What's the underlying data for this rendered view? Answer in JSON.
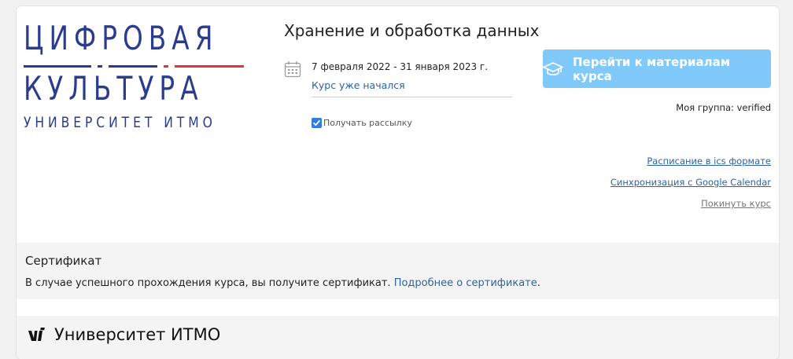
{
  "logo": {
    "line1": "ЦИФРОВАЯ",
    "line2": "КУЛЬТУРА",
    "line3": "УНИВЕРСИТЕТ ИТМО",
    "primary_color": "#2b3c8f",
    "accent_color": "#e0323f"
  },
  "course": {
    "title": "Хранение и обработка данных",
    "dates": "7 февраля 2022 - 31 января 2023 г.",
    "status": "Курс уже начался",
    "newsletter_label": "Получать рассылку",
    "newsletter_checked": true
  },
  "actions": {
    "go_button": "Перейти к материалам курса",
    "my_group": "Моя группа: verified",
    "ics_link": "Расписание в ics формате",
    "google_link": "Синхронизация с Google Calendar",
    "leave_link": "Покинуть курс"
  },
  "certificate": {
    "title": "Сертификат",
    "text": "В случае успешного прохождения курса, вы получите сертификат. ",
    "link": "Подробнее о сертификате",
    "end": "."
  },
  "footer": {
    "name": "Университет ИТМО"
  },
  "colors": {
    "link": "#2a64a8",
    "button": "#7fcafa",
    "checkbox": "#2f7de1"
  }
}
